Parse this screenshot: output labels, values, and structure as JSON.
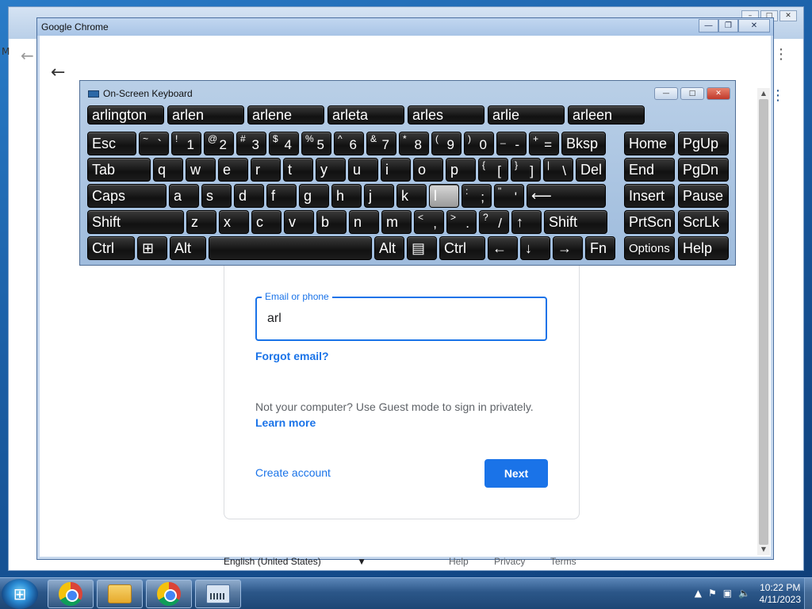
{
  "browser": {
    "title": "Google Chrome",
    "bg_letter": "M"
  },
  "osk": {
    "title": "On-Screen Keyboard",
    "suggestions": [
      "arlington",
      "arlen",
      "arlene",
      "arleta",
      "arles",
      "arlie",
      "arleen"
    ],
    "rows": [
      [
        {
          "label": "Esc"
        },
        {
          "shift": "~",
          "base": "`"
        },
        {
          "shift": "!",
          "base": "1"
        },
        {
          "shift": "@",
          "base": "2"
        },
        {
          "shift": "#",
          "base": "3"
        },
        {
          "shift": "$",
          "base": "4"
        },
        {
          "shift": "%",
          "base": "5"
        },
        {
          "shift": "^",
          "base": "6"
        },
        {
          "shift": "&",
          "base": "7"
        },
        {
          "shift": "*",
          "base": "8"
        },
        {
          "shift": "(",
          "base": "9"
        },
        {
          "shift": ")",
          "base": "0"
        },
        {
          "shift": "_",
          "base": "-"
        },
        {
          "shift": "+",
          "base": "="
        },
        {
          "label": "Bksp"
        }
      ],
      [
        {
          "label": "Tab"
        },
        {
          "label": "q"
        },
        {
          "label": "w"
        },
        {
          "label": "e"
        },
        {
          "label": "r"
        },
        {
          "label": "t"
        },
        {
          "label": "y"
        },
        {
          "label": "u"
        },
        {
          "label": "i"
        },
        {
          "label": "o"
        },
        {
          "label": "p"
        },
        {
          "shift": "{",
          "base": "["
        },
        {
          "shift": "}",
          "base": "]"
        },
        {
          "shift": "|",
          "base": "\\"
        },
        {
          "label": "Del"
        }
      ],
      [
        {
          "label": "Caps"
        },
        {
          "label": "a"
        },
        {
          "label": "s"
        },
        {
          "label": "d"
        },
        {
          "label": "f"
        },
        {
          "label": "g"
        },
        {
          "label": "h"
        },
        {
          "label": "j"
        },
        {
          "label": "k"
        },
        {
          "label": "l",
          "pressed": true
        },
        {
          "shift": ":",
          "base": ";"
        },
        {
          "shift": "\"",
          "base": "'"
        },
        {
          "label": "⟵"
        }
      ],
      [
        {
          "label": "Shift"
        },
        {
          "label": "z"
        },
        {
          "label": "x"
        },
        {
          "label": "c"
        },
        {
          "label": "v"
        },
        {
          "label": "b"
        },
        {
          "label": "n"
        },
        {
          "label": "m"
        },
        {
          "shift": "<",
          "base": ","
        },
        {
          "shift": ">",
          "base": "."
        },
        {
          "shift": "?",
          "base": "/"
        },
        {
          "label": "↑"
        },
        {
          "label": "Shift"
        }
      ],
      [
        {
          "label": "Ctrl"
        },
        {
          "label": "⊞"
        },
        {
          "label": "Alt"
        },
        {
          "label": ""
        },
        {
          "label": "Alt"
        },
        {
          "label": "▤"
        },
        {
          "label": "Ctrl"
        },
        {
          "label": "←"
        },
        {
          "label": "↓"
        },
        {
          "label": "→"
        },
        {
          "label": "Fn"
        }
      ]
    ],
    "side_keys": [
      [
        "Home",
        "PgUp"
      ],
      [
        "End",
        "PgDn"
      ],
      [
        "Insert",
        "Pause"
      ],
      [
        "PrtScn",
        "ScrLk"
      ],
      [
        "Options",
        "Help"
      ]
    ]
  },
  "signin": {
    "email_label": "Email or phone",
    "email_value": "arl",
    "forgot": "Forgot email?",
    "guest_text": "Not your computer? Use Guest mode to sign in privately.",
    "learn_more": "Learn more",
    "create_account": "Create account",
    "next": "Next"
  },
  "footer": {
    "language": "English (United States)",
    "help": "Help",
    "privacy": "Privacy",
    "terms": "Terms"
  },
  "taskbar": {
    "time": "10:22 PM",
    "date": "4/11/2023"
  }
}
